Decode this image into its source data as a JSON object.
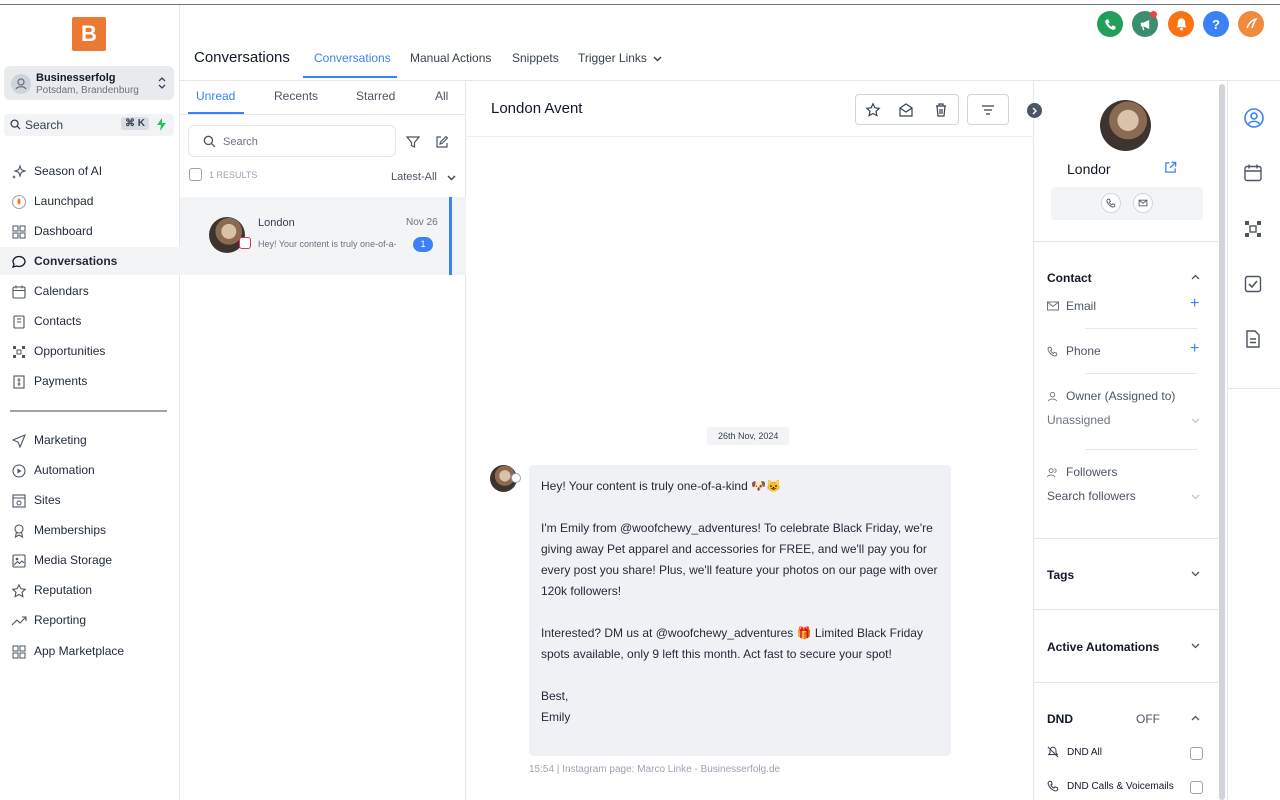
{
  "logo": {
    "letter": "B"
  },
  "account": {
    "name": "Businesserfolg",
    "location": "Potsdam, Brandenburg"
  },
  "search": {
    "label": "Search",
    "shortcut": "⌘ K"
  },
  "nav": {
    "items": [
      {
        "label": "Season of AI",
        "icon": "sparkle-icon"
      },
      {
        "label": "Launchpad",
        "icon": "rocket-icon"
      },
      {
        "label": "Dashboard",
        "icon": "dashboard-icon"
      },
      {
        "label": "Conversations",
        "icon": "chat-bubble-icon"
      },
      {
        "label": "Calendars",
        "icon": "calendar-icon"
      },
      {
        "label": "Contacts",
        "icon": "contacts-icon"
      },
      {
        "label": "Opportunities",
        "icon": "pipeline-icon"
      },
      {
        "label": "Payments",
        "icon": "payments-icon"
      },
      {
        "label": "Marketing",
        "icon": "send-icon"
      },
      {
        "label": "Automation",
        "icon": "automation-icon"
      },
      {
        "label": "Sites",
        "icon": "sites-icon"
      },
      {
        "label": "Memberships",
        "icon": "membership-icon"
      },
      {
        "label": "Media Storage",
        "icon": "image-icon"
      },
      {
        "label": "Reputation",
        "icon": "star-icon"
      },
      {
        "label": "Reporting",
        "icon": "trend-icon"
      },
      {
        "label": "App Marketplace",
        "icon": "grid-icon"
      }
    ]
  },
  "header": {
    "title": "Conversations",
    "tabs": [
      "Conversations",
      "Manual Actions",
      "Snippets",
      "Trigger Links"
    ],
    "top_icons": [
      {
        "name": "phone-icon",
        "color": "#22a05b"
      },
      {
        "name": "megaphone-icon",
        "color": "#3b8f6e"
      },
      {
        "name": "bell-icon",
        "color": "#f97316"
      },
      {
        "name": "help-icon",
        "color": "#3b82f6"
      },
      {
        "name": "user-avatar",
        "color": "#f08a3c"
      }
    ]
  },
  "list": {
    "filter_tabs": [
      "Unread",
      "Recents",
      "Starred",
      "All"
    ],
    "search_placeholder": "Search",
    "results": "1 RESULTS",
    "sort": "Latest-All",
    "items": [
      {
        "name": "London",
        "date": "Nov 26",
        "preview": "Hey! Your content is truly one-of-a-kind",
        "unread": "1"
      }
    ]
  },
  "chat": {
    "title": "London Avent",
    "date_separator": "26th Nov, 2024",
    "message": {
      "paragraphs": [
        "Hey! Your content is truly one-of-a-kind 🐶😺",
        "I'm Emily from @woofchewy_adventures! To celebrate Black Friday, we're giving away Pet apparel and accessories for FREE, and we'll pay you for every post you share! Plus, we'll feature your photos on our page with over 120k followers!",
        "Interested? DM us at @woofchewy_adventures 🎁 Limited Black Friday spots available, only 9 left this month. Act fast to secure your spot!",
        "Best,\nEmily"
      ],
      "meta": "15:54 | Instagram page: Marco Linke - Businesserfolg.de"
    }
  },
  "contact": {
    "name": "Londor",
    "section_contact": "Contact",
    "email_label": "Email",
    "phone_label": "Phone",
    "owner_label": "Owner (Assigned to)",
    "owner_value": "Unassigned",
    "followers_label": "Followers",
    "followers_placeholder": "Search followers",
    "tags": "Tags",
    "active_automations": "Active Automations",
    "dnd": "DND",
    "dnd_state": "OFF",
    "dnd_all": "DND All",
    "dnd_calls": "DND Calls & Voicemails"
  }
}
